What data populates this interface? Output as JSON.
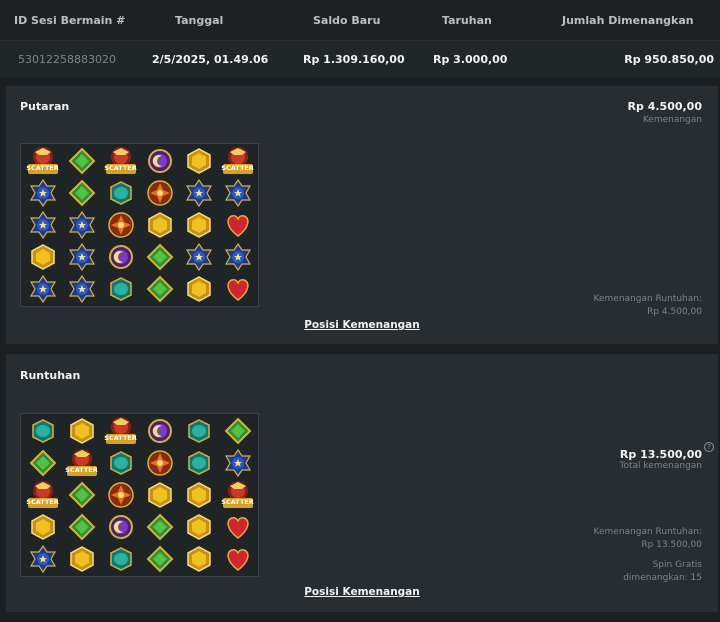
{
  "table": {
    "headers": [
      "ID Sesi Bermain #",
      "Tanggal",
      "Saldo Baru",
      "Taruhan",
      "Jumlah Dimenangkan"
    ],
    "row": {
      "session_id": "53012258883020",
      "date": "2/5/2025, 01.49.06",
      "balance": "Rp 1.309.160,00",
      "bet": "Rp 3.000,00",
      "won": "Rp 950.850,00"
    }
  },
  "panels": [
    {
      "title": "Putaran",
      "amount": "Rp 4.500,00",
      "amount_label": "Kemenangan",
      "cascade_label": "Kemenangan Runtuhan:",
      "cascade_value": "Rp 4.500,00",
      "link": "Posisi Kemenangan",
      "grid": [
        [
          "scatter",
          "green",
          "scatter",
          "purple",
          "yellow",
          "scatter"
        ],
        [
          "blue",
          "green",
          "teal",
          "red",
          "blue",
          "blue"
        ],
        [
          "blue",
          "blue",
          "red",
          "yellow",
          "yellow",
          "heart"
        ],
        [
          "yellow",
          "blue",
          "purple",
          "green",
          "blue",
          "blue"
        ],
        [
          "blue",
          "blue",
          "teal",
          "green",
          "yellow",
          "heart"
        ]
      ]
    },
    {
      "title": "Runtuhan",
      "amount": "Rp 13.500,00",
      "amount_label": "Total kemenangan",
      "help": "?",
      "cascade_label": "Kemenangan Runtuhan:",
      "cascade_value": "Rp 13.500,00",
      "free_spin_label": "Spin Gratis",
      "free_spin_value": "dimenangkan: 15",
      "link": "Posisi Kemenangan",
      "grid": [
        [
          "teal",
          "yellow",
          "scatter",
          "purple",
          "teal",
          "green"
        ],
        [
          "green",
          "scatter",
          "teal",
          "red",
          "teal",
          "blue"
        ],
        [
          "scatter",
          "green",
          "red",
          "yellow",
          "yellow",
          "scatter"
        ],
        [
          "yellow",
          "green",
          "purple",
          "green",
          "yellow",
          "heart"
        ],
        [
          "blue",
          "yellow",
          "teal",
          "green",
          "yellow",
          "heart"
        ]
      ]
    }
  ],
  "symbols": {
    "scatter": {
      "label": "SCATTER",
      "color": "#c93a2a"
    },
    "green": {
      "color": "#4fc34a"
    },
    "purple": {
      "color": "#7d3ac0"
    },
    "yellow": {
      "color": "#f0c21f"
    },
    "blue": {
      "color": "#2a58c9"
    },
    "teal": {
      "color": "#27b3a4"
    },
    "red": {
      "color": "#e8741a"
    },
    "heart": {
      "color": "#d4222e"
    }
  }
}
